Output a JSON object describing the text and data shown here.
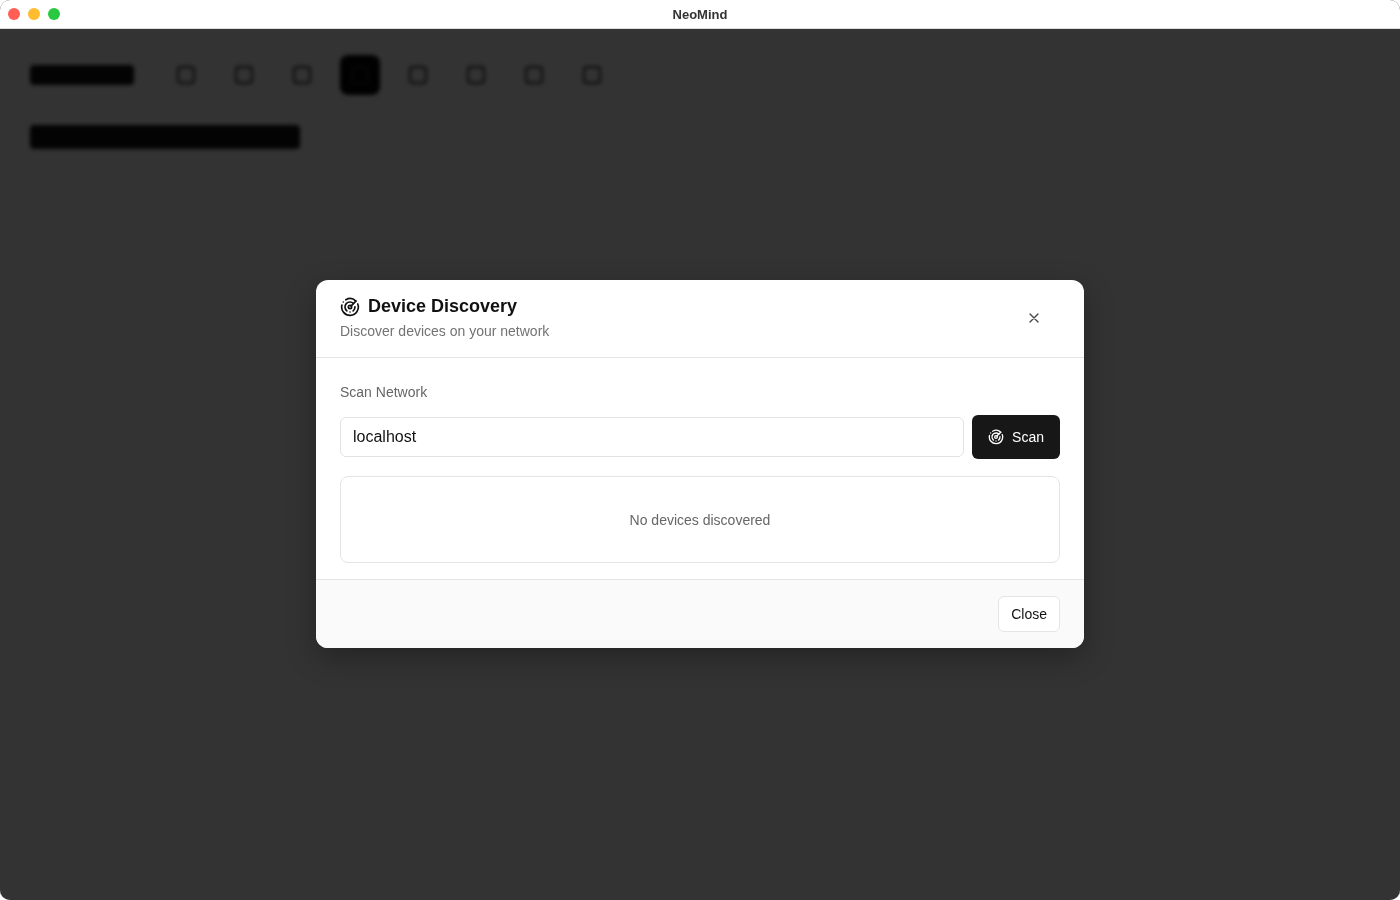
{
  "window": {
    "title": "NeoMind"
  },
  "dialog": {
    "title": "Device Discovery",
    "subtitle": "Discover devices on your network",
    "section_label": "Scan Network",
    "field": {
      "value": "localhost"
    },
    "scan_button": "Scan",
    "empty_message": "No devices discovered",
    "close_button": "Close"
  }
}
